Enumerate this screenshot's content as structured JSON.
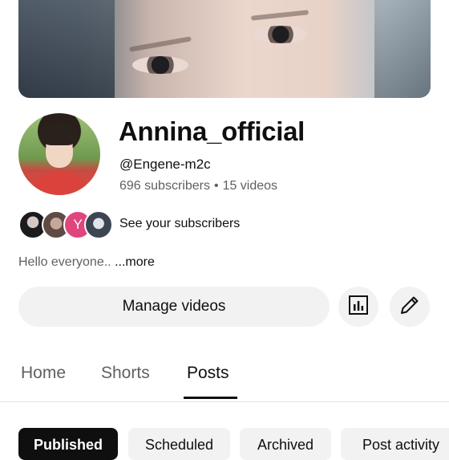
{
  "channel": {
    "name": "Annina_official",
    "handle": "@Engene-m2c",
    "subscribers": "696 subscribers",
    "videos": "15 videos",
    "separator": "•"
  },
  "subscribers_preview": {
    "avatar_letter": "Y",
    "label": "See your subscribers"
  },
  "about": {
    "text": "Hello everyone.. ",
    "more": "...more"
  },
  "actions": {
    "manage_videos": "Manage videos",
    "analytics_icon": "bar-chart-icon",
    "edit_icon": "pencil-icon"
  },
  "tabs": [
    {
      "label": "Home"
    },
    {
      "label": "Shorts"
    },
    {
      "label": "Posts",
      "selected": true
    }
  ],
  "chips": [
    {
      "label": "Published",
      "selected": true
    },
    {
      "label": "Scheduled"
    },
    {
      "label": "Archived"
    },
    {
      "label": "Post activity"
    }
  ]
}
